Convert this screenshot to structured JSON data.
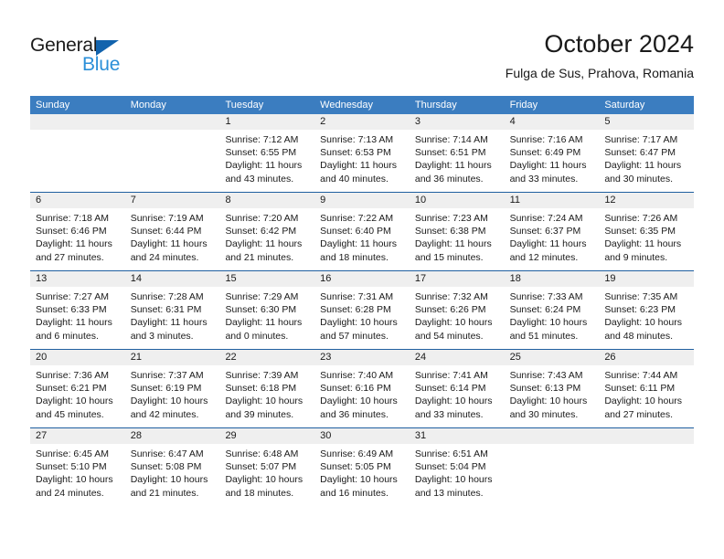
{
  "brand": {
    "name_part1": "General",
    "name_part2": "Blue",
    "triangle_color": "#1263ad",
    "blue_color": "#2b8fd8"
  },
  "header": {
    "title": "October 2024",
    "subtitle": "Fulga de Sus, Prahova, Romania"
  },
  "theme": {
    "header_band": "#3b7dc0",
    "week_divider": "#1f5fa0",
    "daynum_strip": "#efefef"
  },
  "labels": {
    "sunrise_prefix": "Sunrise:",
    "sunset_prefix": "Sunset:",
    "daylight_prefix": "Daylight:"
  },
  "weekdays": [
    "Sunday",
    "Monday",
    "Tuesday",
    "Wednesday",
    "Thursday",
    "Friday",
    "Saturday"
  ],
  "weeks": [
    [
      {
        "day": "",
        "sunrise": "",
        "sunset": "",
        "daylight_line1": "",
        "daylight_line2": ""
      },
      {
        "day": "",
        "sunrise": "",
        "sunset": "",
        "daylight_line1": "",
        "daylight_line2": ""
      },
      {
        "day": "1",
        "sunrise": "Sunrise: 7:12 AM",
        "sunset": "Sunset: 6:55 PM",
        "daylight_line1": "Daylight: 11 hours",
        "daylight_line2": "and 43 minutes."
      },
      {
        "day": "2",
        "sunrise": "Sunrise: 7:13 AM",
        "sunset": "Sunset: 6:53 PM",
        "daylight_line1": "Daylight: 11 hours",
        "daylight_line2": "and 40 minutes."
      },
      {
        "day": "3",
        "sunrise": "Sunrise: 7:14 AM",
        "sunset": "Sunset: 6:51 PM",
        "daylight_line1": "Daylight: 11 hours",
        "daylight_line2": "and 36 minutes."
      },
      {
        "day": "4",
        "sunrise": "Sunrise: 7:16 AM",
        "sunset": "Sunset: 6:49 PM",
        "daylight_line1": "Daylight: 11 hours",
        "daylight_line2": "and 33 minutes."
      },
      {
        "day": "5",
        "sunrise": "Sunrise: 7:17 AM",
        "sunset": "Sunset: 6:47 PM",
        "daylight_line1": "Daylight: 11 hours",
        "daylight_line2": "and 30 minutes."
      }
    ],
    [
      {
        "day": "6",
        "sunrise": "Sunrise: 7:18 AM",
        "sunset": "Sunset: 6:46 PM",
        "daylight_line1": "Daylight: 11 hours",
        "daylight_line2": "and 27 minutes."
      },
      {
        "day": "7",
        "sunrise": "Sunrise: 7:19 AM",
        "sunset": "Sunset: 6:44 PM",
        "daylight_line1": "Daylight: 11 hours",
        "daylight_line2": "and 24 minutes."
      },
      {
        "day": "8",
        "sunrise": "Sunrise: 7:20 AM",
        "sunset": "Sunset: 6:42 PM",
        "daylight_line1": "Daylight: 11 hours",
        "daylight_line2": "and 21 minutes."
      },
      {
        "day": "9",
        "sunrise": "Sunrise: 7:22 AM",
        "sunset": "Sunset: 6:40 PM",
        "daylight_line1": "Daylight: 11 hours",
        "daylight_line2": "and 18 minutes."
      },
      {
        "day": "10",
        "sunrise": "Sunrise: 7:23 AM",
        "sunset": "Sunset: 6:38 PM",
        "daylight_line1": "Daylight: 11 hours",
        "daylight_line2": "and 15 minutes."
      },
      {
        "day": "11",
        "sunrise": "Sunrise: 7:24 AM",
        "sunset": "Sunset: 6:37 PM",
        "daylight_line1": "Daylight: 11 hours",
        "daylight_line2": "and 12 minutes."
      },
      {
        "day": "12",
        "sunrise": "Sunrise: 7:26 AM",
        "sunset": "Sunset: 6:35 PM",
        "daylight_line1": "Daylight: 11 hours",
        "daylight_line2": "and 9 minutes."
      }
    ],
    [
      {
        "day": "13",
        "sunrise": "Sunrise: 7:27 AM",
        "sunset": "Sunset: 6:33 PM",
        "daylight_line1": "Daylight: 11 hours",
        "daylight_line2": "and 6 minutes."
      },
      {
        "day": "14",
        "sunrise": "Sunrise: 7:28 AM",
        "sunset": "Sunset: 6:31 PM",
        "daylight_line1": "Daylight: 11 hours",
        "daylight_line2": "and 3 minutes."
      },
      {
        "day": "15",
        "sunrise": "Sunrise: 7:29 AM",
        "sunset": "Sunset: 6:30 PM",
        "daylight_line1": "Daylight: 11 hours",
        "daylight_line2": "and 0 minutes."
      },
      {
        "day": "16",
        "sunrise": "Sunrise: 7:31 AM",
        "sunset": "Sunset: 6:28 PM",
        "daylight_line1": "Daylight: 10 hours",
        "daylight_line2": "and 57 minutes."
      },
      {
        "day": "17",
        "sunrise": "Sunrise: 7:32 AM",
        "sunset": "Sunset: 6:26 PM",
        "daylight_line1": "Daylight: 10 hours",
        "daylight_line2": "and 54 minutes."
      },
      {
        "day": "18",
        "sunrise": "Sunrise: 7:33 AM",
        "sunset": "Sunset: 6:24 PM",
        "daylight_line1": "Daylight: 10 hours",
        "daylight_line2": "and 51 minutes."
      },
      {
        "day": "19",
        "sunrise": "Sunrise: 7:35 AM",
        "sunset": "Sunset: 6:23 PM",
        "daylight_line1": "Daylight: 10 hours",
        "daylight_line2": "and 48 minutes."
      }
    ],
    [
      {
        "day": "20",
        "sunrise": "Sunrise: 7:36 AM",
        "sunset": "Sunset: 6:21 PM",
        "daylight_line1": "Daylight: 10 hours",
        "daylight_line2": "and 45 minutes."
      },
      {
        "day": "21",
        "sunrise": "Sunrise: 7:37 AM",
        "sunset": "Sunset: 6:19 PM",
        "daylight_line1": "Daylight: 10 hours",
        "daylight_line2": "and 42 minutes."
      },
      {
        "day": "22",
        "sunrise": "Sunrise: 7:39 AM",
        "sunset": "Sunset: 6:18 PM",
        "daylight_line1": "Daylight: 10 hours",
        "daylight_line2": "and 39 minutes."
      },
      {
        "day": "23",
        "sunrise": "Sunrise: 7:40 AM",
        "sunset": "Sunset: 6:16 PM",
        "daylight_line1": "Daylight: 10 hours",
        "daylight_line2": "and 36 minutes."
      },
      {
        "day": "24",
        "sunrise": "Sunrise: 7:41 AM",
        "sunset": "Sunset: 6:14 PM",
        "daylight_line1": "Daylight: 10 hours",
        "daylight_line2": "and 33 minutes."
      },
      {
        "day": "25",
        "sunrise": "Sunrise: 7:43 AM",
        "sunset": "Sunset: 6:13 PM",
        "daylight_line1": "Daylight: 10 hours",
        "daylight_line2": "and 30 minutes."
      },
      {
        "day": "26",
        "sunrise": "Sunrise: 7:44 AM",
        "sunset": "Sunset: 6:11 PM",
        "daylight_line1": "Daylight: 10 hours",
        "daylight_line2": "and 27 minutes."
      }
    ],
    [
      {
        "day": "27",
        "sunrise": "Sunrise: 6:45 AM",
        "sunset": "Sunset: 5:10 PM",
        "daylight_line1": "Daylight: 10 hours",
        "daylight_line2": "and 24 minutes."
      },
      {
        "day": "28",
        "sunrise": "Sunrise: 6:47 AM",
        "sunset": "Sunset: 5:08 PM",
        "daylight_line1": "Daylight: 10 hours",
        "daylight_line2": "and 21 minutes."
      },
      {
        "day": "29",
        "sunrise": "Sunrise: 6:48 AM",
        "sunset": "Sunset: 5:07 PM",
        "daylight_line1": "Daylight: 10 hours",
        "daylight_line2": "and 18 minutes."
      },
      {
        "day": "30",
        "sunrise": "Sunrise: 6:49 AM",
        "sunset": "Sunset: 5:05 PM",
        "daylight_line1": "Daylight: 10 hours",
        "daylight_line2": "and 16 minutes."
      },
      {
        "day": "31",
        "sunrise": "Sunrise: 6:51 AM",
        "sunset": "Sunset: 5:04 PM",
        "daylight_line1": "Daylight: 10 hours",
        "daylight_line2": "and 13 minutes."
      },
      {
        "day": "",
        "sunrise": "",
        "sunset": "",
        "daylight_line1": "",
        "daylight_line2": ""
      },
      {
        "day": "",
        "sunrise": "",
        "sunset": "",
        "daylight_line1": "",
        "daylight_line2": ""
      }
    ]
  ]
}
